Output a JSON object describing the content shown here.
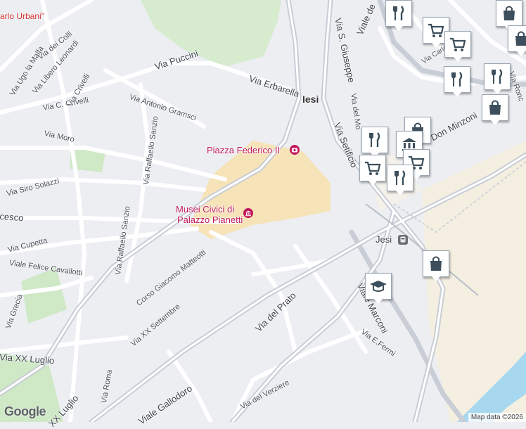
{
  "map": {
    "town": "Iesi",
    "labels": {
      "carlo_urbani": "arlo Urbani\"",
      "via_dei_colli": "Via dei Colli",
      "via_ugo_la_malfa": "Via Ugo la Malfa",
      "via_libero_leonardi": "Via Libero Leonardi",
      "via_puccini": "Via Puccini",
      "via_erbarella": "Via Erbarella",
      "via_c_crivelli": "Via C. Crivelli",
      "via_crivelli": "Via Crivelli",
      "via_antonio_gramsci": "Via Antonio Gramsci",
      "via_moro": "Via Moro",
      "via_raffaello_sanzio_1": "Via Raffaello Sanzio",
      "via_raffaello_sanzio_2": "Via Raffaello Sanzio",
      "via_siro_solazzi": "Via Siro Solazzi",
      "cesco": "cesco",
      "via_cupetta": "Via Cupetta",
      "viale_felice_cavallotti": "Viale Felice Cavallotti",
      "via_grecia": "Via Grecia",
      "corso_giacomo_matteotti": "Corso Giacomo Matteotti",
      "via_xx_settembre": "Via XX Settembre",
      "via_xx_luglio_1": "Via XX Luglio",
      "via_xx_luglio_2": "XX Luglio",
      "via_roma": "Via Roma",
      "viale_gallodoro": "Viale Gallodoro",
      "via_del_verziere": "Via del Verziere",
      "via_del_prato": "Via del Prato",
      "viale_marconi": "Viale Marconi",
      "via_e_fermi": "Via E.Fermi",
      "via_s_giuseppe": "Via S. Giuseppe",
      "via_del_mo": "Via del Mo",
      "via_setificio": "Via Setificio",
      "viale_de": "Viale de",
      "via_card": "Via Carlere",
      "via_ronc": "Via Ronc",
      "don_minzoni": "Don Minzoni",
      "iesi_station": "Jesi",
      "piazza_federico": "Piazza Federico II",
      "musei_civici_1": "Musei Civici di",
      "musei_civici_2": "Palazzo Pianetti"
    },
    "colors": {
      "background": "#eceef2",
      "road": "#ffffff",
      "arterial": "#c8cdd6",
      "old_town": "#f6e3b8",
      "park": "#cfe8c6",
      "river": "#a7d8ef",
      "pin_icon": "#3d4f5c",
      "poi_pink": "#c2185b"
    }
  },
  "markers": [
    {
      "id": "shopping-bag-1",
      "icon": "shopping-bag-icon"
    },
    {
      "id": "shopping-cart-1",
      "icon": "shopping-cart-icon"
    },
    {
      "id": "restaurant-1",
      "icon": "restaurant-icon"
    },
    {
      "id": "shopping-bag-2",
      "icon": "shopping-bag-icon"
    },
    {
      "id": "shopping-bag-3",
      "icon": "shopping-bag-icon"
    },
    {
      "id": "restaurant-2",
      "icon": "restaurant-icon"
    },
    {
      "id": "museum-1",
      "icon": "museum-icon"
    },
    {
      "id": "shopping-cart-2",
      "icon": "shopping-cart-icon"
    },
    {
      "id": "restaurant-3",
      "icon": "restaurant-icon"
    },
    {
      "id": "shopping-bag-4",
      "icon": "shopping-bag-icon"
    },
    {
      "id": "school-1",
      "icon": "school-icon"
    }
  ],
  "footer": {
    "google": "Google",
    "attribution": "Map data ©2026"
  }
}
